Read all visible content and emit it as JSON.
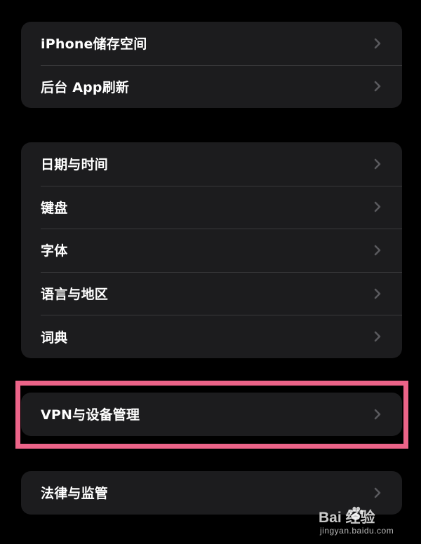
{
  "groups": [
    {
      "rows": [
        {
          "label": "iPhone储存空间"
        },
        {
          "label": "后台 App刷新"
        }
      ]
    },
    {
      "rows": [
        {
          "label": "日期与时间"
        },
        {
          "label": "键盘"
        },
        {
          "label": "字体"
        },
        {
          "label": "语言与地区"
        },
        {
          "label": "词典"
        }
      ]
    },
    {
      "rows": [
        {
          "label": "VPN与设备管理"
        }
      ]
    },
    {
      "rows": [
        {
          "label": "法律与监管"
        }
      ]
    }
  ],
  "highlight_color": "#ec6489",
  "icons": {
    "row_chevron": "chevron-right-icon"
  },
  "watermark": {
    "logo": "Bai  经验",
    "site": "jingyan.baidu.com"
  }
}
